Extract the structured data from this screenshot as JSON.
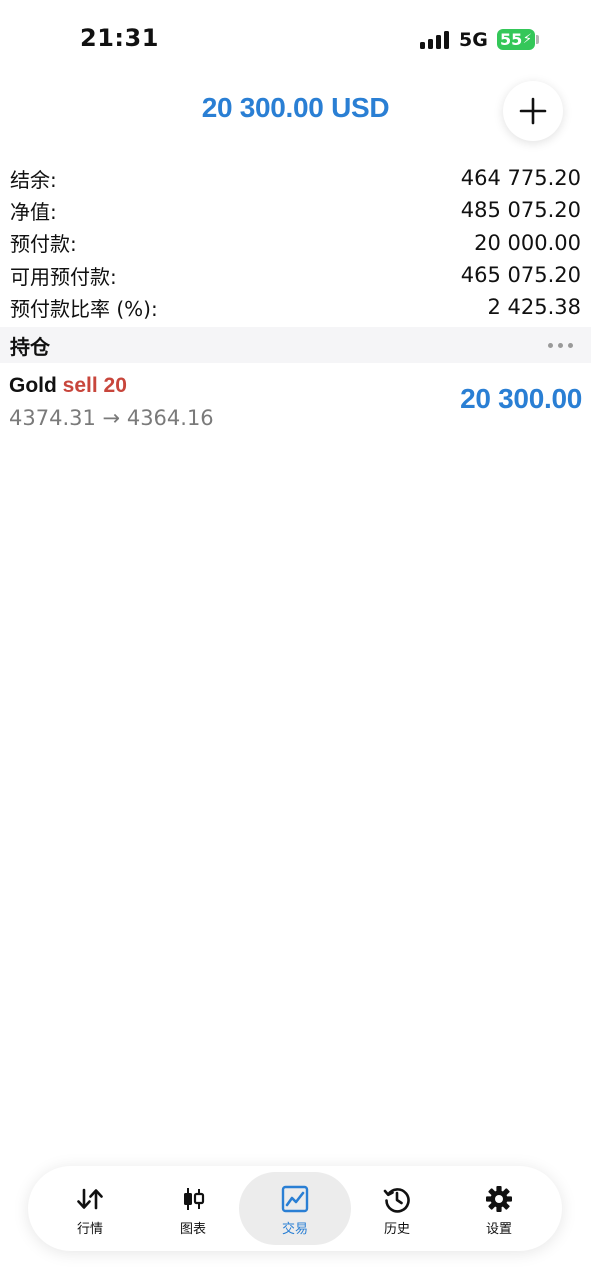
{
  "status_bar": {
    "time": "21:31",
    "network": "5G",
    "battery": "55"
  },
  "header": {
    "title": "20 300.00 USD"
  },
  "summary": [
    {
      "label": "结余:",
      "value": "464 775.20"
    },
    {
      "label": "净值:",
      "value": "485 075.20"
    },
    {
      "label": "预付款:",
      "value": "20 000.00"
    },
    {
      "label": "可用预付款:",
      "value": "465 075.20"
    },
    {
      "label": "预付款比率 (%):",
      "value": "2 425.38"
    }
  ],
  "positions_section": {
    "title": "持仓"
  },
  "position": {
    "symbol": "Gold",
    "side": "sell",
    "volume": "20",
    "open_price": "4374.31",
    "arrow": "→",
    "current_price": "4364.16",
    "profit": "20 300.00"
  },
  "tabs": [
    {
      "label": "行情",
      "icon": "quotes-arrows-icon",
      "active": false
    },
    {
      "label": "图表",
      "icon": "candlestick-chart-icon",
      "active": false
    },
    {
      "label": "交易",
      "icon": "trade-chart-icon",
      "active": true
    },
    {
      "label": "历史",
      "icon": "history-clock-icon",
      "active": false
    },
    {
      "label": "设置",
      "icon": "gear-icon",
      "active": false
    }
  ],
  "colors": {
    "accent_blue": "#2a7fd4",
    "sell_red": "#c8463c",
    "battery_green": "#34c759"
  }
}
